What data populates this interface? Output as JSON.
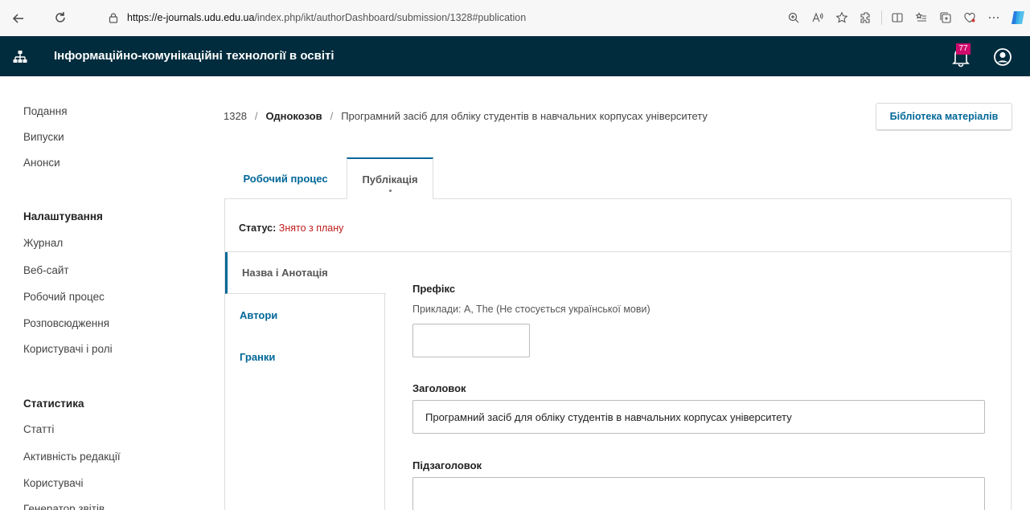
{
  "browser": {
    "url_host": "https://e-journals.udu.edu.ua",
    "url_path": "/index.php/ikt/authorDashboard/submission/1328#publication"
  },
  "header": {
    "site_title": "Інформаційно-комунікаційні технології в освіті",
    "notification_count": "77",
    "colors": {
      "header_bg": "#002c3d",
      "badge": "#d00a6c",
      "accent": "#006798"
    }
  },
  "sidebar": {
    "items_top": [
      "Подання",
      "Випуски",
      "Анонси"
    ],
    "settings_heading": "Налаштування",
    "settings_items": [
      "Журнал",
      "Веб-сайт",
      "Робочий процес",
      "Розповсюдження",
      "Користувачі і ролі"
    ],
    "stats_heading": "Статистика",
    "stats_items": [
      "Статті",
      "Активність редакції",
      "Користувачі",
      "Генератор звітів"
    ]
  },
  "breadcrumb": {
    "id": "1328",
    "author": "Однокозов",
    "title": "Програмний засіб для обліку студентів в навчальних корпусах університету"
  },
  "library_button": "Бібліотека матеріалів",
  "tabs": {
    "workflow": "Робочий процес",
    "publication": "Публікація"
  },
  "status": {
    "label": "Статус:",
    "value": "Знято з плану"
  },
  "subnav": {
    "items": [
      "Назва і Анотація",
      "Автори",
      "Гранки"
    ]
  },
  "form": {
    "prefix_label": "Префікс",
    "prefix_desc": "Приклади: A, The (Не стосується української мови)",
    "prefix_value": "",
    "title_label": "Заголовок",
    "title_value": "Програмний засіб для обліку студентів в навчальних корпусах університету",
    "subtitle_label": "Підзаголовок",
    "subtitle_value": ""
  }
}
